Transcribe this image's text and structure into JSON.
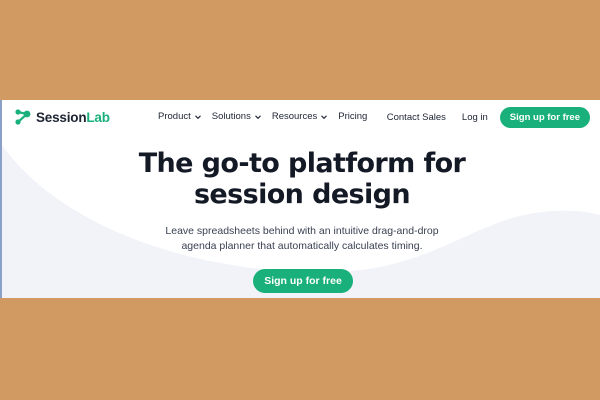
{
  "brand": {
    "name_part1": "Session",
    "name_part2": "Lab",
    "logo_icon": "sessionlab-logo-icon",
    "accent_color": "#19B07B"
  },
  "nav": {
    "items": [
      {
        "label": "Product",
        "has_dropdown": true
      },
      {
        "label": "Solutions",
        "has_dropdown": true
      },
      {
        "label": "Resources",
        "has_dropdown": true
      },
      {
        "label": "Pricing",
        "has_dropdown": false
      }
    ],
    "contact_label": "Contact Sales",
    "login_label": "Log in",
    "signup_label": "Sign up for free"
  },
  "hero": {
    "title_line1": "The go-to platform for",
    "title_line2": "session design",
    "subtitle_line1": "Leave spreadsheets behind with an intuitive drag-and-drop",
    "subtitle_line2": "agenda planner that automatically calculates timing.",
    "cta_label": "Sign up for free"
  },
  "colors": {
    "page_background": "#D19A63",
    "content_background": "#FFFFFF",
    "button_green": "#19B07B",
    "text_dark": "#141926"
  }
}
